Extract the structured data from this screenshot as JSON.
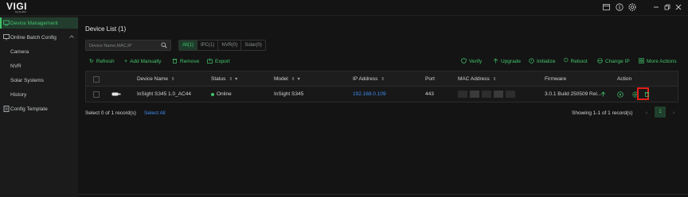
{
  "app": {
    "logo": "VIGI",
    "logo_sub": "by tp-link"
  },
  "window": {
    "icons": [
      "book-icon",
      "info-icon",
      "settings-icon",
      "minimize-icon",
      "restore-icon",
      "close-icon"
    ]
  },
  "sidebar": {
    "items": [
      {
        "label": "Device Management",
        "icon": "device-management-icon",
        "active": true
      },
      {
        "label": "Online Batch Config",
        "icon": "batch-config-icon",
        "expanded": true
      },
      {
        "label": "Camera"
      },
      {
        "label": "NVR"
      },
      {
        "label": "Solar Systems"
      },
      {
        "label": "History"
      },
      {
        "label": "Config Template",
        "icon": "template-icon"
      }
    ]
  },
  "main": {
    "title": "Device List (1)",
    "search_placeholder": "Device Name,MAC,IP",
    "filter_tabs": [
      {
        "label": "All(1)",
        "active": true
      },
      {
        "label": "IPC(1)"
      },
      {
        "label": "NVR(0)"
      },
      {
        "label": "Solar(0)"
      }
    ],
    "toolbar_left": [
      {
        "label": "Refresh",
        "icon": "refresh-icon"
      },
      {
        "label": "Add Manually",
        "icon": "plus-icon"
      },
      {
        "label": "Remove",
        "icon": "trash-icon"
      },
      {
        "label": "Export",
        "icon": "export-icon"
      }
    ],
    "toolbar_right": [
      {
        "label": "Verify",
        "icon": "shield-icon"
      },
      {
        "label": "Upgrade",
        "icon": "upgrade-icon"
      },
      {
        "label": "Initialize",
        "icon": "initialize-icon"
      },
      {
        "label": "Reboot",
        "icon": "reboot-icon"
      },
      {
        "label": "Change IP",
        "icon": "change-ip-icon"
      },
      {
        "label": "More Actions",
        "icon": "grid-icon"
      }
    ],
    "table": {
      "headers": {
        "device_name": "Device Name",
        "status": "Status",
        "model": "Model",
        "ip": "IP Address",
        "port": "Port",
        "mac": "MAC Address",
        "firmware": "Firmware",
        "action": "Action"
      },
      "rows": [
        {
          "device_name": "InSight S345 1.0_AC44",
          "status": "Online",
          "model": "InSight S345",
          "ip": "192.168.0.109",
          "port": "443",
          "firmware": "3.0.1 Build 250509 Rel..."
        }
      ]
    },
    "footer": {
      "selected": "Select 0 of 1 record(s)",
      "select_all": "Select All",
      "showing": "Showing 1-1 of 1 record(s)",
      "page": "1"
    }
  },
  "colors": {
    "accent": "#42c36b",
    "link": "#3d8bf0",
    "highlight": "#e0201a",
    "background": "#141414"
  }
}
